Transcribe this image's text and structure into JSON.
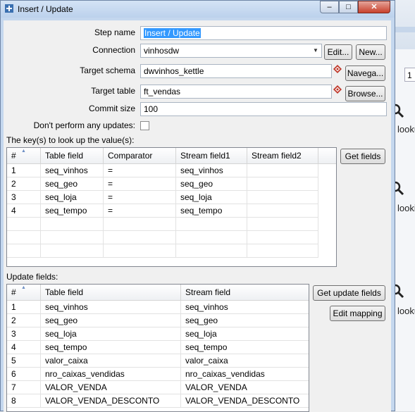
{
  "window": {
    "title": "Insert / Update"
  },
  "form": {
    "step_name": {
      "label": "Step name",
      "value": "Insert / Update"
    },
    "connection": {
      "label": "Connection",
      "value": "vinhosdw",
      "edit_label": "Edit...",
      "new_label": "New..."
    },
    "target_schema": {
      "label": "Target schema",
      "value": "dwvinhos_kettle",
      "browse_label": "Navega..."
    },
    "target_table": {
      "label": "Target table",
      "value": "ft_vendas",
      "browse_label": "Browse..."
    },
    "commit_size": {
      "label": "Commit size",
      "value": "100"
    },
    "no_updates": {
      "label": "Don't perform any updates:",
      "checked": false
    }
  },
  "keys": {
    "section_label": "The key(s) to look up the value(s):",
    "get_fields_label": "Get fields",
    "columns": [
      "#",
      "Table field",
      "Comparator",
      "Stream field1",
      "Stream field2"
    ],
    "rows": [
      [
        "1",
        "seq_vinhos",
        "=",
        "seq_vinhos",
        ""
      ],
      [
        "2",
        "seq_geo",
        "=",
        "seq_geo",
        ""
      ],
      [
        "3",
        "seq_loja",
        "=",
        "seq_loja",
        ""
      ],
      [
        "4",
        "seq_tempo",
        "=",
        "seq_tempo",
        ""
      ]
    ]
  },
  "update": {
    "section_label": "Update fields:",
    "get_update_fields_label": "Get update fields",
    "edit_mapping_label": "Edit mapping",
    "columns": [
      "#",
      "Table field",
      "Stream field"
    ],
    "rows": [
      [
        "1",
        "seq_vinhos",
        "seq_vinhos"
      ],
      [
        "2",
        "seq_geo",
        "seq_geo"
      ],
      [
        "3",
        "seq_loja",
        "seq_loja"
      ],
      [
        "4",
        "seq_tempo",
        "seq_tempo"
      ],
      [
        "5",
        "valor_caixa",
        "valor_caixa"
      ],
      [
        "6",
        "nro_caixas_vendidas",
        "nro_caixas_vendidas"
      ],
      [
        "7",
        "VALOR_VENDA",
        "VALOR_VENDA"
      ],
      [
        "8",
        "VALOR_VENDA_DESCONTO",
        "VALOR_VENDA_DESCONTO"
      ]
    ]
  },
  "background": {
    "field_value": "1",
    "labels": [
      "looku",
      "looki",
      "looku"
    ]
  },
  "colors": {
    "selection": "#3399ff",
    "titlebar": "#c4d7ee",
    "close_button": "#c7402c"
  }
}
